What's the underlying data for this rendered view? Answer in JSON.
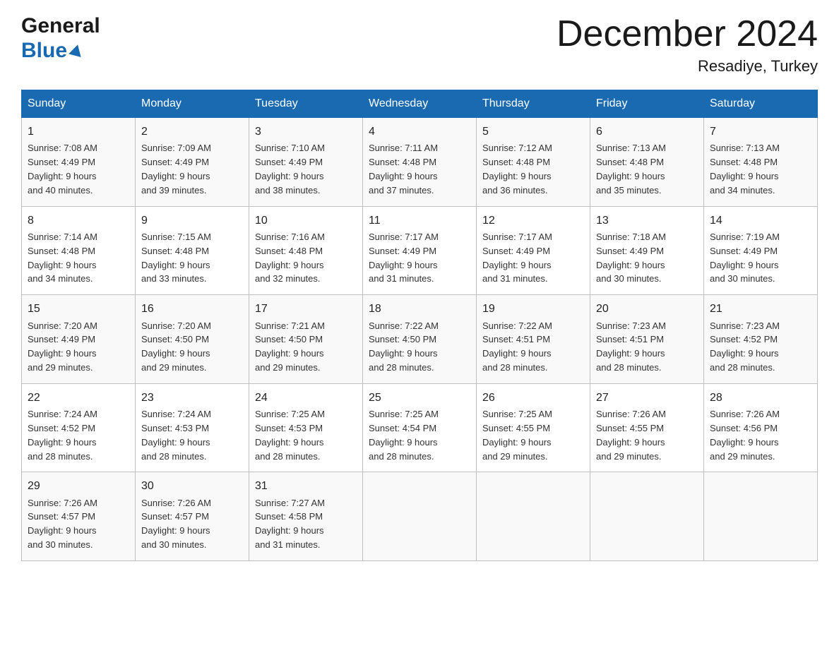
{
  "logo": {
    "line1": "General",
    "line2": "Blue"
  },
  "title": "December 2024",
  "location": "Resadiye, Turkey",
  "days_of_week": [
    "Sunday",
    "Monday",
    "Tuesday",
    "Wednesday",
    "Thursday",
    "Friday",
    "Saturday"
  ],
  "weeks": [
    [
      {
        "day": "1",
        "sunrise": "Sunrise: 7:08 AM",
        "sunset": "Sunset: 4:49 PM",
        "daylight": "Daylight: 9 hours",
        "daylight2": "and 40 minutes."
      },
      {
        "day": "2",
        "sunrise": "Sunrise: 7:09 AM",
        "sunset": "Sunset: 4:49 PM",
        "daylight": "Daylight: 9 hours",
        "daylight2": "and 39 minutes."
      },
      {
        "day": "3",
        "sunrise": "Sunrise: 7:10 AM",
        "sunset": "Sunset: 4:49 PM",
        "daylight": "Daylight: 9 hours",
        "daylight2": "and 38 minutes."
      },
      {
        "day": "4",
        "sunrise": "Sunrise: 7:11 AM",
        "sunset": "Sunset: 4:48 PM",
        "daylight": "Daylight: 9 hours",
        "daylight2": "and 37 minutes."
      },
      {
        "day": "5",
        "sunrise": "Sunrise: 7:12 AM",
        "sunset": "Sunset: 4:48 PM",
        "daylight": "Daylight: 9 hours",
        "daylight2": "and 36 minutes."
      },
      {
        "day": "6",
        "sunrise": "Sunrise: 7:13 AM",
        "sunset": "Sunset: 4:48 PM",
        "daylight": "Daylight: 9 hours",
        "daylight2": "and 35 minutes."
      },
      {
        "day": "7",
        "sunrise": "Sunrise: 7:13 AM",
        "sunset": "Sunset: 4:48 PM",
        "daylight": "Daylight: 9 hours",
        "daylight2": "and 34 minutes."
      }
    ],
    [
      {
        "day": "8",
        "sunrise": "Sunrise: 7:14 AM",
        "sunset": "Sunset: 4:48 PM",
        "daylight": "Daylight: 9 hours",
        "daylight2": "and 34 minutes."
      },
      {
        "day": "9",
        "sunrise": "Sunrise: 7:15 AM",
        "sunset": "Sunset: 4:48 PM",
        "daylight": "Daylight: 9 hours",
        "daylight2": "and 33 minutes."
      },
      {
        "day": "10",
        "sunrise": "Sunrise: 7:16 AM",
        "sunset": "Sunset: 4:48 PM",
        "daylight": "Daylight: 9 hours",
        "daylight2": "and 32 minutes."
      },
      {
        "day": "11",
        "sunrise": "Sunrise: 7:17 AM",
        "sunset": "Sunset: 4:49 PM",
        "daylight": "Daylight: 9 hours",
        "daylight2": "and 31 minutes."
      },
      {
        "day": "12",
        "sunrise": "Sunrise: 7:17 AM",
        "sunset": "Sunset: 4:49 PM",
        "daylight": "Daylight: 9 hours",
        "daylight2": "and 31 minutes."
      },
      {
        "day": "13",
        "sunrise": "Sunrise: 7:18 AM",
        "sunset": "Sunset: 4:49 PM",
        "daylight": "Daylight: 9 hours",
        "daylight2": "and 30 minutes."
      },
      {
        "day": "14",
        "sunrise": "Sunrise: 7:19 AM",
        "sunset": "Sunset: 4:49 PM",
        "daylight": "Daylight: 9 hours",
        "daylight2": "and 30 minutes."
      }
    ],
    [
      {
        "day": "15",
        "sunrise": "Sunrise: 7:20 AM",
        "sunset": "Sunset: 4:49 PM",
        "daylight": "Daylight: 9 hours",
        "daylight2": "and 29 minutes."
      },
      {
        "day": "16",
        "sunrise": "Sunrise: 7:20 AM",
        "sunset": "Sunset: 4:50 PM",
        "daylight": "Daylight: 9 hours",
        "daylight2": "and 29 minutes."
      },
      {
        "day": "17",
        "sunrise": "Sunrise: 7:21 AM",
        "sunset": "Sunset: 4:50 PM",
        "daylight": "Daylight: 9 hours",
        "daylight2": "and 29 minutes."
      },
      {
        "day": "18",
        "sunrise": "Sunrise: 7:22 AM",
        "sunset": "Sunset: 4:50 PM",
        "daylight": "Daylight: 9 hours",
        "daylight2": "and 28 minutes."
      },
      {
        "day": "19",
        "sunrise": "Sunrise: 7:22 AM",
        "sunset": "Sunset: 4:51 PM",
        "daylight": "Daylight: 9 hours",
        "daylight2": "and 28 minutes."
      },
      {
        "day": "20",
        "sunrise": "Sunrise: 7:23 AM",
        "sunset": "Sunset: 4:51 PM",
        "daylight": "Daylight: 9 hours",
        "daylight2": "and 28 minutes."
      },
      {
        "day": "21",
        "sunrise": "Sunrise: 7:23 AM",
        "sunset": "Sunset: 4:52 PM",
        "daylight": "Daylight: 9 hours",
        "daylight2": "and 28 minutes."
      }
    ],
    [
      {
        "day": "22",
        "sunrise": "Sunrise: 7:24 AM",
        "sunset": "Sunset: 4:52 PM",
        "daylight": "Daylight: 9 hours",
        "daylight2": "and 28 minutes."
      },
      {
        "day": "23",
        "sunrise": "Sunrise: 7:24 AM",
        "sunset": "Sunset: 4:53 PM",
        "daylight": "Daylight: 9 hours",
        "daylight2": "and 28 minutes."
      },
      {
        "day": "24",
        "sunrise": "Sunrise: 7:25 AM",
        "sunset": "Sunset: 4:53 PM",
        "daylight": "Daylight: 9 hours",
        "daylight2": "and 28 minutes."
      },
      {
        "day": "25",
        "sunrise": "Sunrise: 7:25 AM",
        "sunset": "Sunset: 4:54 PM",
        "daylight": "Daylight: 9 hours",
        "daylight2": "and 28 minutes."
      },
      {
        "day": "26",
        "sunrise": "Sunrise: 7:25 AM",
        "sunset": "Sunset: 4:55 PM",
        "daylight": "Daylight: 9 hours",
        "daylight2": "and 29 minutes."
      },
      {
        "day": "27",
        "sunrise": "Sunrise: 7:26 AM",
        "sunset": "Sunset: 4:55 PM",
        "daylight": "Daylight: 9 hours",
        "daylight2": "and 29 minutes."
      },
      {
        "day": "28",
        "sunrise": "Sunrise: 7:26 AM",
        "sunset": "Sunset: 4:56 PM",
        "daylight": "Daylight: 9 hours",
        "daylight2": "and 29 minutes."
      }
    ],
    [
      {
        "day": "29",
        "sunrise": "Sunrise: 7:26 AM",
        "sunset": "Sunset: 4:57 PM",
        "daylight": "Daylight: 9 hours",
        "daylight2": "and 30 minutes."
      },
      {
        "day": "30",
        "sunrise": "Sunrise: 7:26 AM",
        "sunset": "Sunset: 4:57 PM",
        "daylight": "Daylight: 9 hours",
        "daylight2": "and 30 minutes."
      },
      {
        "day": "31",
        "sunrise": "Sunrise: 7:27 AM",
        "sunset": "Sunset: 4:58 PM",
        "daylight": "Daylight: 9 hours",
        "daylight2": "and 31 minutes."
      },
      {
        "day": "",
        "sunrise": "",
        "sunset": "",
        "daylight": "",
        "daylight2": ""
      },
      {
        "day": "",
        "sunrise": "",
        "sunset": "",
        "daylight": "",
        "daylight2": ""
      },
      {
        "day": "",
        "sunrise": "",
        "sunset": "",
        "daylight": "",
        "daylight2": ""
      },
      {
        "day": "",
        "sunrise": "",
        "sunset": "",
        "daylight": "",
        "daylight2": ""
      }
    ]
  ]
}
